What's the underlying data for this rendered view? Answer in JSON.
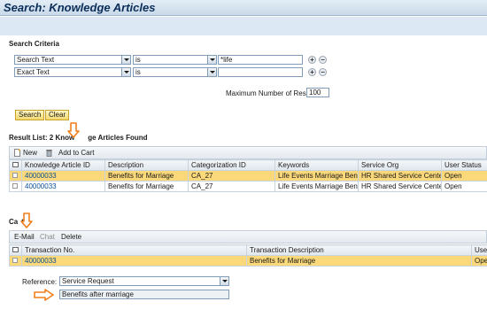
{
  "page": {
    "title": "Search: Knowledge Articles"
  },
  "criteria": {
    "heading": "Search Criteria",
    "rows": [
      {
        "field": "Search Text",
        "operator": "is",
        "value": "*life"
      },
      {
        "field": "Exact Text",
        "operator": "is",
        "value": ""
      }
    ],
    "max_label": "Maximum Number of Results:",
    "max_value": "100",
    "search_label": "Search",
    "clear_label": "Clear"
  },
  "results": {
    "heading_prefix": "Result List: 2 Know",
    "heading_suffix": "ge Articles Found",
    "toolbar": {
      "new_label": "New",
      "add_to_cart_label": "Add to Cart"
    },
    "columns": [
      "Knowledge Article ID",
      "Description",
      "Categorization ID",
      "Keywords",
      "Service Org",
      "User Status"
    ],
    "rows": [
      {
        "id": "40000033",
        "description": "Benefits for Marriage",
        "category": "CA_27",
        "keywords": "Life Events Marriage Benef...",
        "service_org": "HR Shared Service Center",
        "status": "Open",
        "selected": true
      },
      {
        "id": "40000033",
        "description": "Benefits for Marriage",
        "category": "CA_27",
        "keywords": "Life Events Marriage Benef...",
        "service_org": "HR Shared Service Center",
        "status": "Open",
        "selected": false
      }
    ]
  },
  "cart": {
    "heading_prefix": "Ca",
    "heading_suffix": "t",
    "toolbar": {
      "email_label": "E-Mail",
      "chat_label": "Chat",
      "delete_label": "Delete"
    },
    "columns": [
      "Transaction No.",
      "Transaction Description",
      "User"
    ],
    "rows": [
      {
        "no": "40000033",
        "description": "Benefits for Marriage",
        "user": "Open"
      }
    ],
    "reference_label": "Reference:",
    "reference_value": "Service Request",
    "reference_text": "Benefits after marriage"
  },
  "colors": {
    "highlight": "#fbd97a",
    "arrow": "#f07f1a",
    "title": "#0b2e59"
  },
  "icons": [
    "new-document-icon",
    "trash-icon",
    "table-settings-icon",
    "orange-arrow-icon"
  ]
}
